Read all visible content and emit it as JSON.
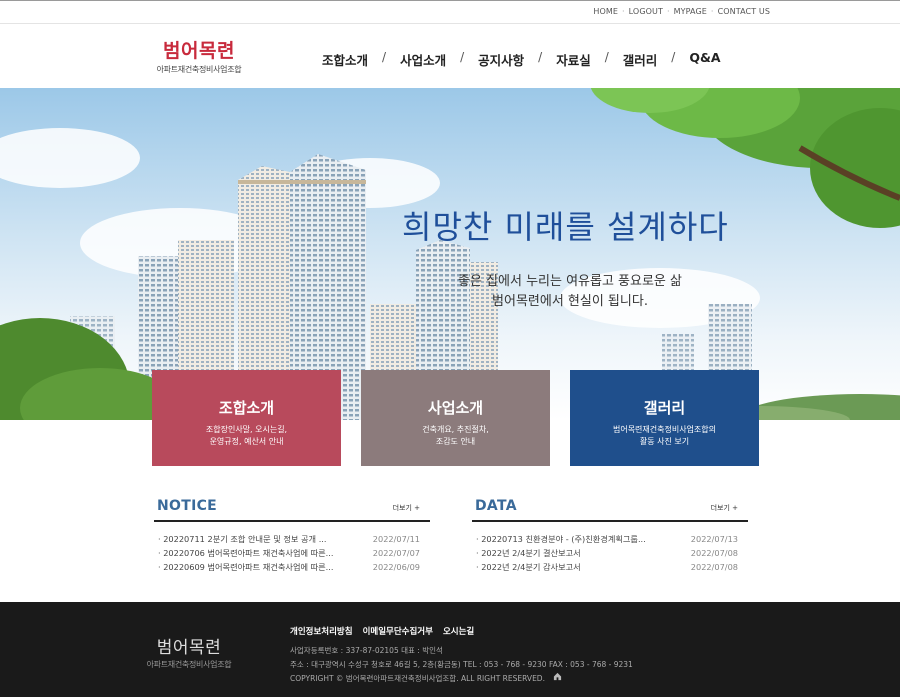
{
  "util": {
    "links": [
      "HOME",
      "LOGOUT",
      "MYPAGE",
      "CONTACT US"
    ]
  },
  "logo": {
    "main": "범어목련",
    "sub": "아파트재건축정비사업조합"
  },
  "gnb": [
    "조합소개",
    "사업소개",
    "공지사항",
    "자료실",
    "갤러리",
    "Q&A"
  ],
  "hero": {
    "title": "희망찬 미래를 설계하다",
    "sub1": "좋은 집에서 누리는 여유롭고 풍요로운 삶",
    "sub2": "범어목련에서 현실이 됩니다."
  },
  "boxes": [
    {
      "title": "조합소개",
      "desc1": "조합장인사말, 오시는길,",
      "desc2": "운영규정, 예산서 안내"
    },
    {
      "title": "사업소개",
      "desc1": "건축개요, 추진절차,",
      "desc2": "조감도 안내"
    },
    {
      "title": "갤러리",
      "desc1": "범어목련재건축정비사업조합의",
      "desc2": "활동 사진 보기"
    }
  ],
  "notice": {
    "title": "NOTICE",
    "more": "더보기 +",
    "items": [
      {
        "title": "· 20220711 2분기 조합 안내문 및 정보 공개 ...",
        "date": "2022/07/11"
      },
      {
        "title": "· 20220706 범어목련아파트 재건축사업에 따른...",
        "date": "2022/07/07"
      },
      {
        "title": "· 20220609 범어목련아파트 재건축사업에 따른...",
        "date": "2022/06/09"
      }
    ]
  },
  "data_board": {
    "title": "DATA",
    "more": "더보기 +",
    "items": [
      {
        "title": "· 20220713 친환경분야 - (주)친환경계획그룹...",
        "date": "2022/07/13"
      },
      {
        "title": "· 2022년 2/4분기 결산보고서",
        "date": "2022/07/08"
      },
      {
        "title": "· 2022년 2/4분기 감사보고서",
        "date": "2022/07/08"
      }
    ]
  },
  "footer": {
    "logo_main": "범어목련",
    "logo_sub": "아파트재건축정비사업조합",
    "links": [
      "개인정보처리방침",
      "이메일무단수집거부",
      "오시는길"
    ],
    "line1": "사업자등록번호 : 337-87-02105    대표 : 박인석",
    "line2": "주소 : 대구광역시 수성구 청호로 46길 5, 2층(황금동)    TEL : 053 - 768 - 9230    FAX : 053 - 768 - 9231",
    "line3": "COPYRIGHT © 범어목련아파트재건축정비사업조합. ALL RIGHT RESERVED."
  }
}
